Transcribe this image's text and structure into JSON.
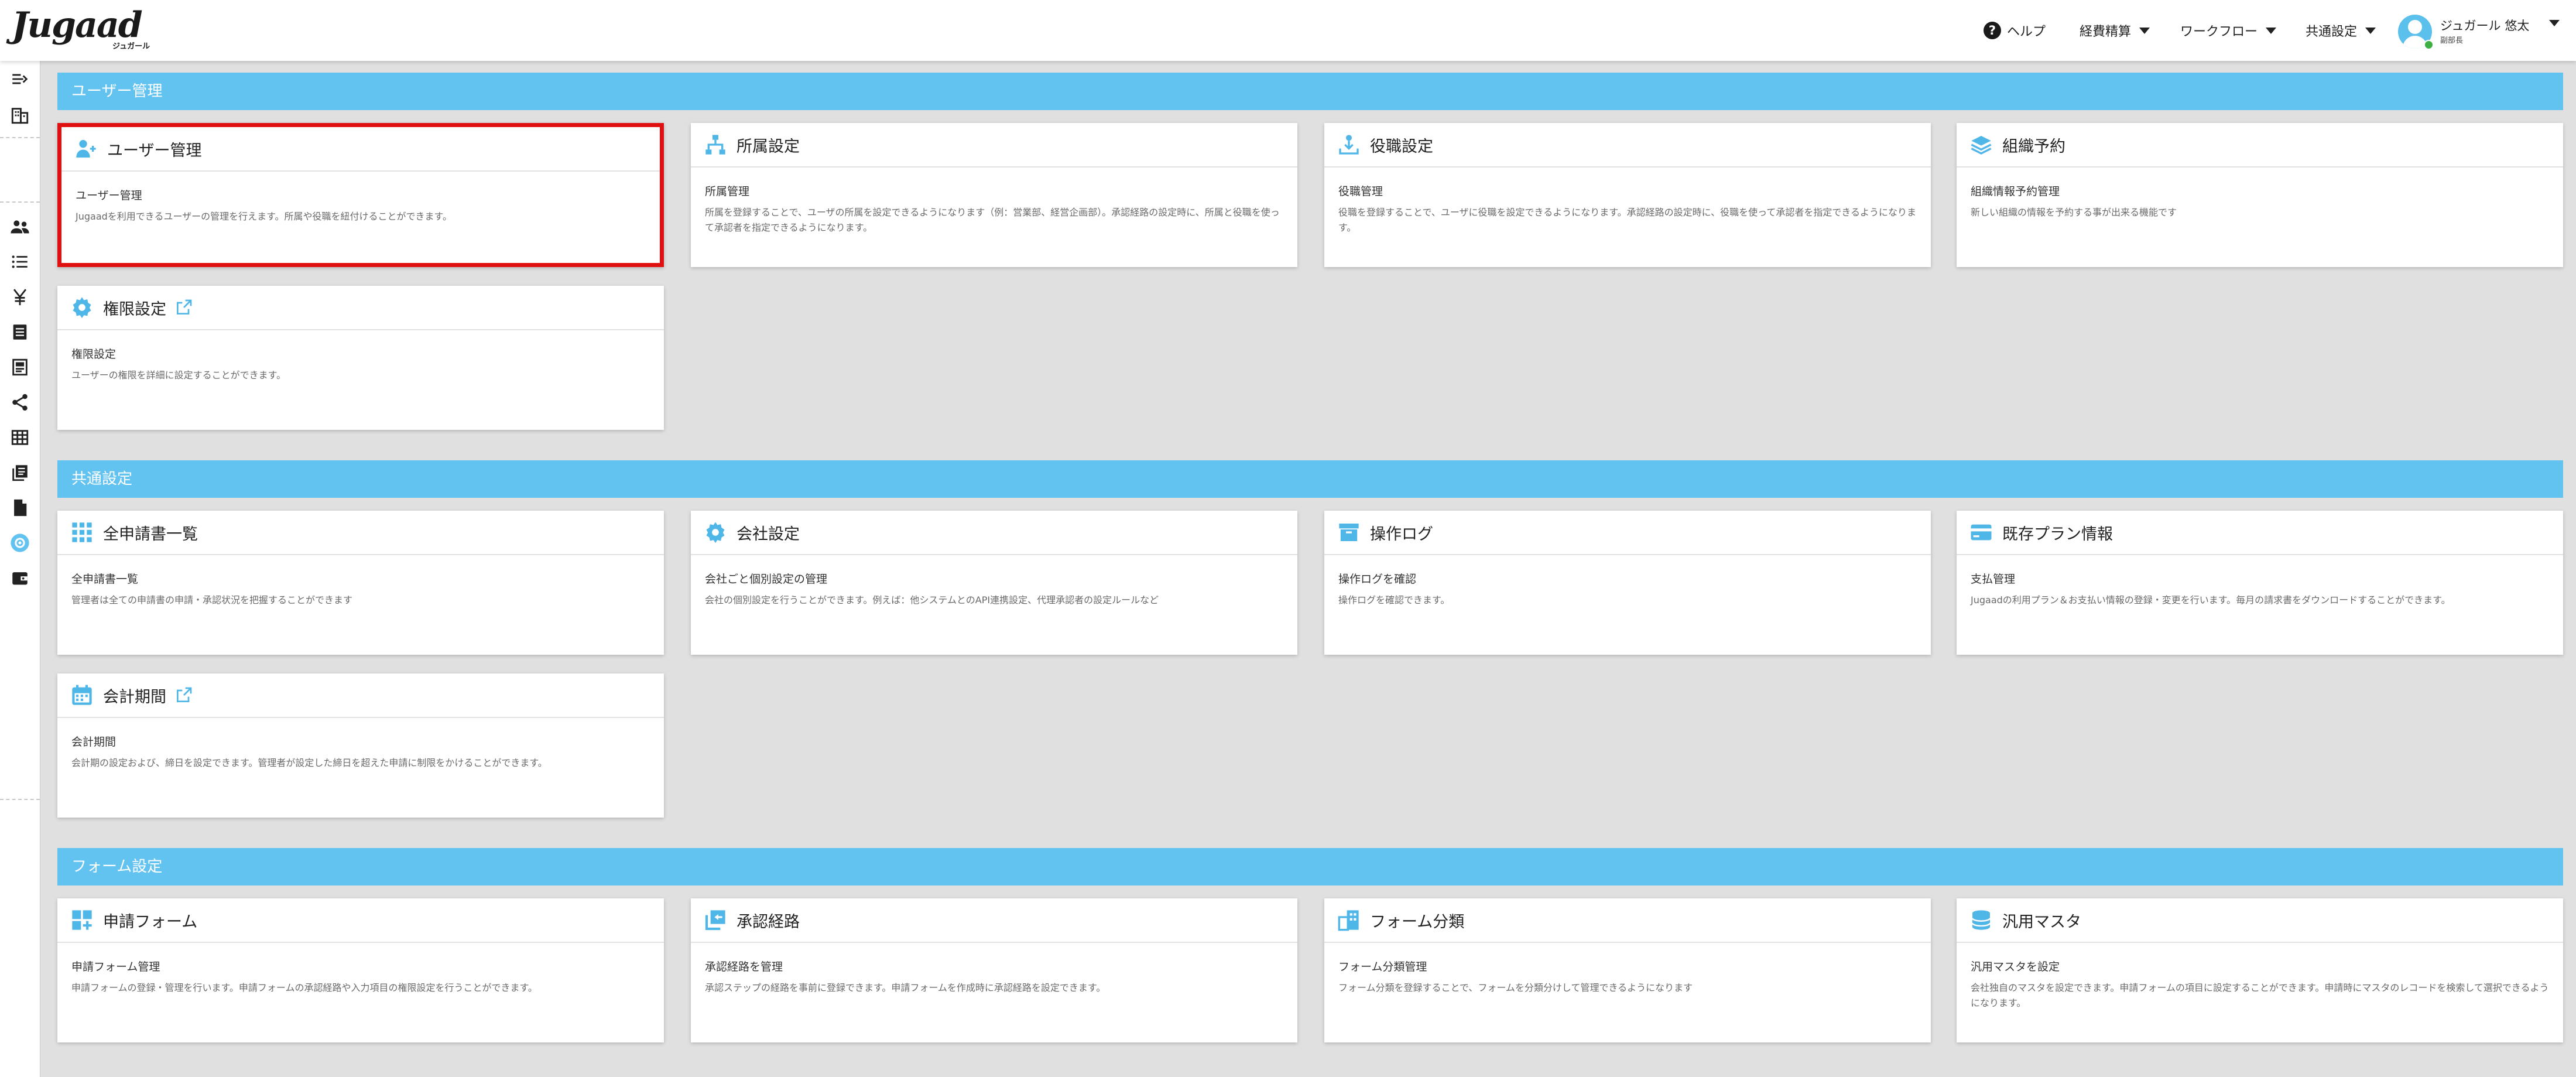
{
  "header": {
    "logo_main": "Jugaad",
    "logo_sub": "ジュガール",
    "help": "ヘルプ",
    "nav": [
      "経費精算",
      "ワークフロー",
      "共通設定"
    ],
    "user_name": "ジュガール 悠太",
    "user_role": "副部長"
  },
  "colors": {
    "accent": "#63c3f0",
    "icon": "#4fb6e8",
    "highlight": "#e01010"
  },
  "sections": [
    {
      "title": "ユーザー管理",
      "cards": [
        {
          "title": "ユーザー管理",
          "icon": "user-plus-icon",
          "subtitle": "ユーザー管理",
          "description": "Jugaadを利用できるユーザーの管理を行えます。所属や役職を紐付けることができます。"
        },
        {
          "title": "所属設定",
          "icon": "org-chart-icon",
          "subtitle": "所属管理",
          "description": "所属を登録することで、ユーザの所属を設定できるようになります（例：営業部、経営企画部）。承認経路の設定時に、所属と役職を使って承認者を指定できるようになります。"
        },
        {
          "title": "役職設定",
          "icon": "role-icon",
          "subtitle": "役職管理",
          "description": "役職を登録することで、ユーザに役職を設定できるようになります。承認経路の設定時に、役職を使って承認者を指定できるようになります。"
        },
        {
          "title": "組織予約",
          "icon": "layers-icon",
          "subtitle": "組織情報予約管理",
          "description": "新しい組織の情報を予約する事が出来る機能です"
        },
        {
          "title": "権限設定",
          "icon": "gear-icon",
          "subtitle": "権限設定",
          "description": "ユーザーの権限を詳細に設定することができます。"
        }
      ]
    },
    {
      "title": "共通設定",
      "cards": [
        {
          "title": "全申請書一覧",
          "icon": "grid-icon",
          "subtitle": "全申請書一覧",
          "description": "管理者は全ての申請書の申請・承認状況を把握することができます"
        },
        {
          "title": "会社設定",
          "icon": "gear-icon",
          "subtitle": "会社ごと個別設定の管理",
          "description": "会社の個別設定を行うことができます。例えば：他システムとのAPI連携設定、代理承認者の設定ルールなど"
        },
        {
          "title": "操作ログ",
          "icon": "archive-icon",
          "subtitle": "操作ログを確認",
          "description": "操作ログを確認できます。"
        },
        {
          "title": "既存プラン情報",
          "icon": "credit-card-icon",
          "subtitle": "支払管理",
          "description": "Jugaadの利用プラン＆お支払い情報の登録・変更を行います。毎月の請求書をダウンロードすることができます。"
        },
        {
          "title": "会計期間",
          "icon": "calendar-icon",
          "subtitle": "会計期間",
          "description": "会計期の設定および、締日を設定できます。管理者が設定した締日を超えた申請に制限をかけることができます。"
        }
      ]
    },
    {
      "title": "フォーム設定",
      "cards": [
        {
          "title": "申請フォーム",
          "icon": "form-blocks-icon",
          "subtitle": "申請フォーム管理",
          "description": "申請フォームの登録・管理を行います。申請フォームの承認経路や入力項目の権限設定を行うことができます。"
        },
        {
          "title": "承認経路",
          "icon": "route-icon",
          "subtitle": "承認経路を管理",
          "description": "承認ステップの経路を事前に登録できます。申請フォームを作成時に承認経路を設定できます。"
        },
        {
          "title": "フォーム分類",
          "icon": "folder-icon",
          "subtitle": "フォーム分類管理",
          "description": "フォーム分類を登録することで、フォームを分類分けして管理できるようになります"
        },
        {
          "title": "汎用マスタ",
          "icon": "database-icon",
          "subtitle": "汎用マスタを設定",
          "description": "会社独自のマスタを設定できます。申請フォームの項目に設定することができます。申請時にマスタのレコードを検索して選択できるようになります。"
        }
      ]
    }
  ]
}
